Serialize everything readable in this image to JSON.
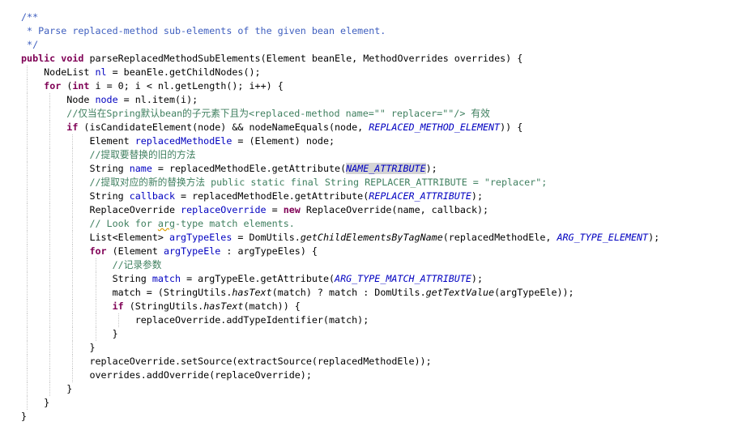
{
  "code_lines": [
    [
      {
        "t": "/**",
        "c": "c"
      }
    ],
    [
      {
        "t": " * Parse replaced-method sub-elements of the given bean element.",
        "c": "c"
      }
    ],
    [
      {
        "t": " */",
        "c": "c"
      }
    ],
    [
      {
        "t": "public",
        "c": "k"
      },
      {
        "t": " "
      },
      {
        "t": "void",
        "c": "k"
      },
      {
        "t": " parseReplacedMethodSubElements(Element beanEle, MethodOverrides overrides) {"
      }
    ],
    [
      {
        "t": "    NodeList "
      },
      {
        "t": "nl",
        "c": "f"
      },
      {
        "t": " = beanEle.getChildNodes();"
      }
    ],
    [
      {
        "t": "    "
      },
      {
        "t": "for",
        "c": "k"
      },
      {
        "t": " ("
      },
      {
        "t": "int",
        "c": "k"
      },
      {
        "t": " i = 0; i < nl.getLength(); i++) {"
      }
    ],
    [
      {
        "t": "        Node "
      },
      {
        "t": "node",
        "c": "f"
      },
      {
        "t": " = nl.item(i);"
      }
    ],
    [
      {
        "t": "        //仅当在Spring默认bean的子元素下且为<replaced-method name=\"\" replacer=\"\"/> 有效",
        "c": "cl"
      }
    ],
    [
      {
        "t": "        "
      },
      {
        "t": "if",
        "c": "k"
      },
      {
        "t": " (isCandidateElement(node) && nodeNameEquals(node, "
      },
      {
        "t": "REPLACED_METHOD_ELEMENT",
        "c": "cst"
      },
      {
        "t": ")) {"
      }
    ],
    [
      {
        "t": "            Element "
      },
      {
        "t": "replacedMethodEle",
        "c": "f"
      },
      {
        "t": " = (Element) node;"
      }
    ],
    [
      {
        "t": "            //提取要替换的旧的方法",
        "c": "cl"
      }
    ],
    [
      {
        "t": "            String "
      },
      {
        "t": "name",
        "c": "f"
      },
      {
        "t": " = replacedMethodEle.getAttribute("
      },
      {
        "t": "NAME_ATTRIBUTE",
        "c": "cst hl"
      },
      {
        "t": ");"
      }
    ],
    [
      {
        "t": "            //提取对应的新的替换方法 public static final String REPLACER_ATTRIBUTE = \"replacer\";",
        "c": "cl"
      }
    ],
    [
      {
        "t": "            String "
      },
      {
        "t": "callback",
        "c": "f"
      },
      {
        "t": " = replacedMethodEle.getAttribute("
      },
      {
        "t": "REPLACER_ATTRIBUTE",
        "c": "cst"
      },
      {
        "t": ");"
      }
    ],
    [
      {
        "t": "            ReplaceOverride "
      },
      {
        "t": "replaceOverride",
        "c": "f"
      },
      {
        "t": " = "
      },
      {
        "t": "new",
        "c": "k"
      },
      {
        "t": " ReplaceOverride(name, callback);"
      }
    ],
    [
      {
        "t": "            // Look for ",
        "c": "cl"
      },
      {
        "t": "arg",
        "c": "cl sq"
      },
      {
        "t": "-type match elements.",
        "c": "cl"
      }
    ],
    [
      {
        "t": "            List<Element> "
      },
      {
        "t": "argTypeEles",
        "c": "f"
      },
      {
        "t": " = DomUtils."
      },
      {
        "t": "getChildElementsByTagName",
        "c": "i"
      },
      {
        "t": "(replacedMethodEle, "
      },
      {
        "t": "ARG_TYPE_ELEMENT",
        "c": "cst"
      },
      {
        "t": ");"
      }
    ],
    [
      {
        "t": "            "
      },
      {
        "t": "for",
        "c": "k"
      },
      {
        "t": " (Element "
      },
      {
        "t": "argTypeEle",
        "c": "f"
      },
      {
        "t": " : argTypeEles) {"
      }
    ],
    [
      {
        "t": "                //记录参数",
        "c": "cl"
      }
    ],
    [
      {
        "t": "                String "
      },
      {
        "t": "match",
        "c": "f"
      },
      {
        "t": " = argTypeEle.getAttribute("
      },
      {
        "t": "ARG_TYPE_MATCH_ATTRIBUTE",
        "c": "cst"
      },
      {
        "t": ");"
      }
    ],
    [
      {
        "t": "                match = (StringUtils."
      },
      {
        "t": "hasText",
        "c": "i"
      },
      {
        "t": "(match) ? match : DomUtils."
      },
      {
        "t": "getTextValue",
        "c": "i"
      },
      {
        "t": "(argTypeEle));"
      }
    ],
    [
      {
        "t": "                "
      },
      {
        "t": "if",
        "c": "k"
      },
      {
        "t": " (StringUtils."
      },
      {
        "t": "hasText",
        "c": "i"
      },
      {
        "t": "(match)) {"
      }
    ],
    [
      {
        "t": "                    replaceOverride.addTypeIdentifier(match);"
      }
    ],
    [
      {
        "t": "                }"
      }
    ],
    [
      {
        "t": "            }"
      }
    ],
    [
      {
        "t": "            replaceOverride.setSource(extractSource(replacedMethodEle));"
      }
    ],
    [
      {
        "t": "            overrides.addOverride(replaceOverride);"
      }
    ],
    [
      {
        "t": "        }"
      }
    ],
    [
      {
        "t": "    }"
      }
    ],
    [
      {
        "t": "}"
      }
    ]
  ],
  "colors": {
    "keyword": "#7f0055",
    "javadoc": "#3f5fbf",
    "line_comment": "#3f7f5f",
    "field": "#0000c0",
    "constant": "#0000c0",
    "highlight": "#d4d4d4",
    "background": "#ffffff"
  }
}
